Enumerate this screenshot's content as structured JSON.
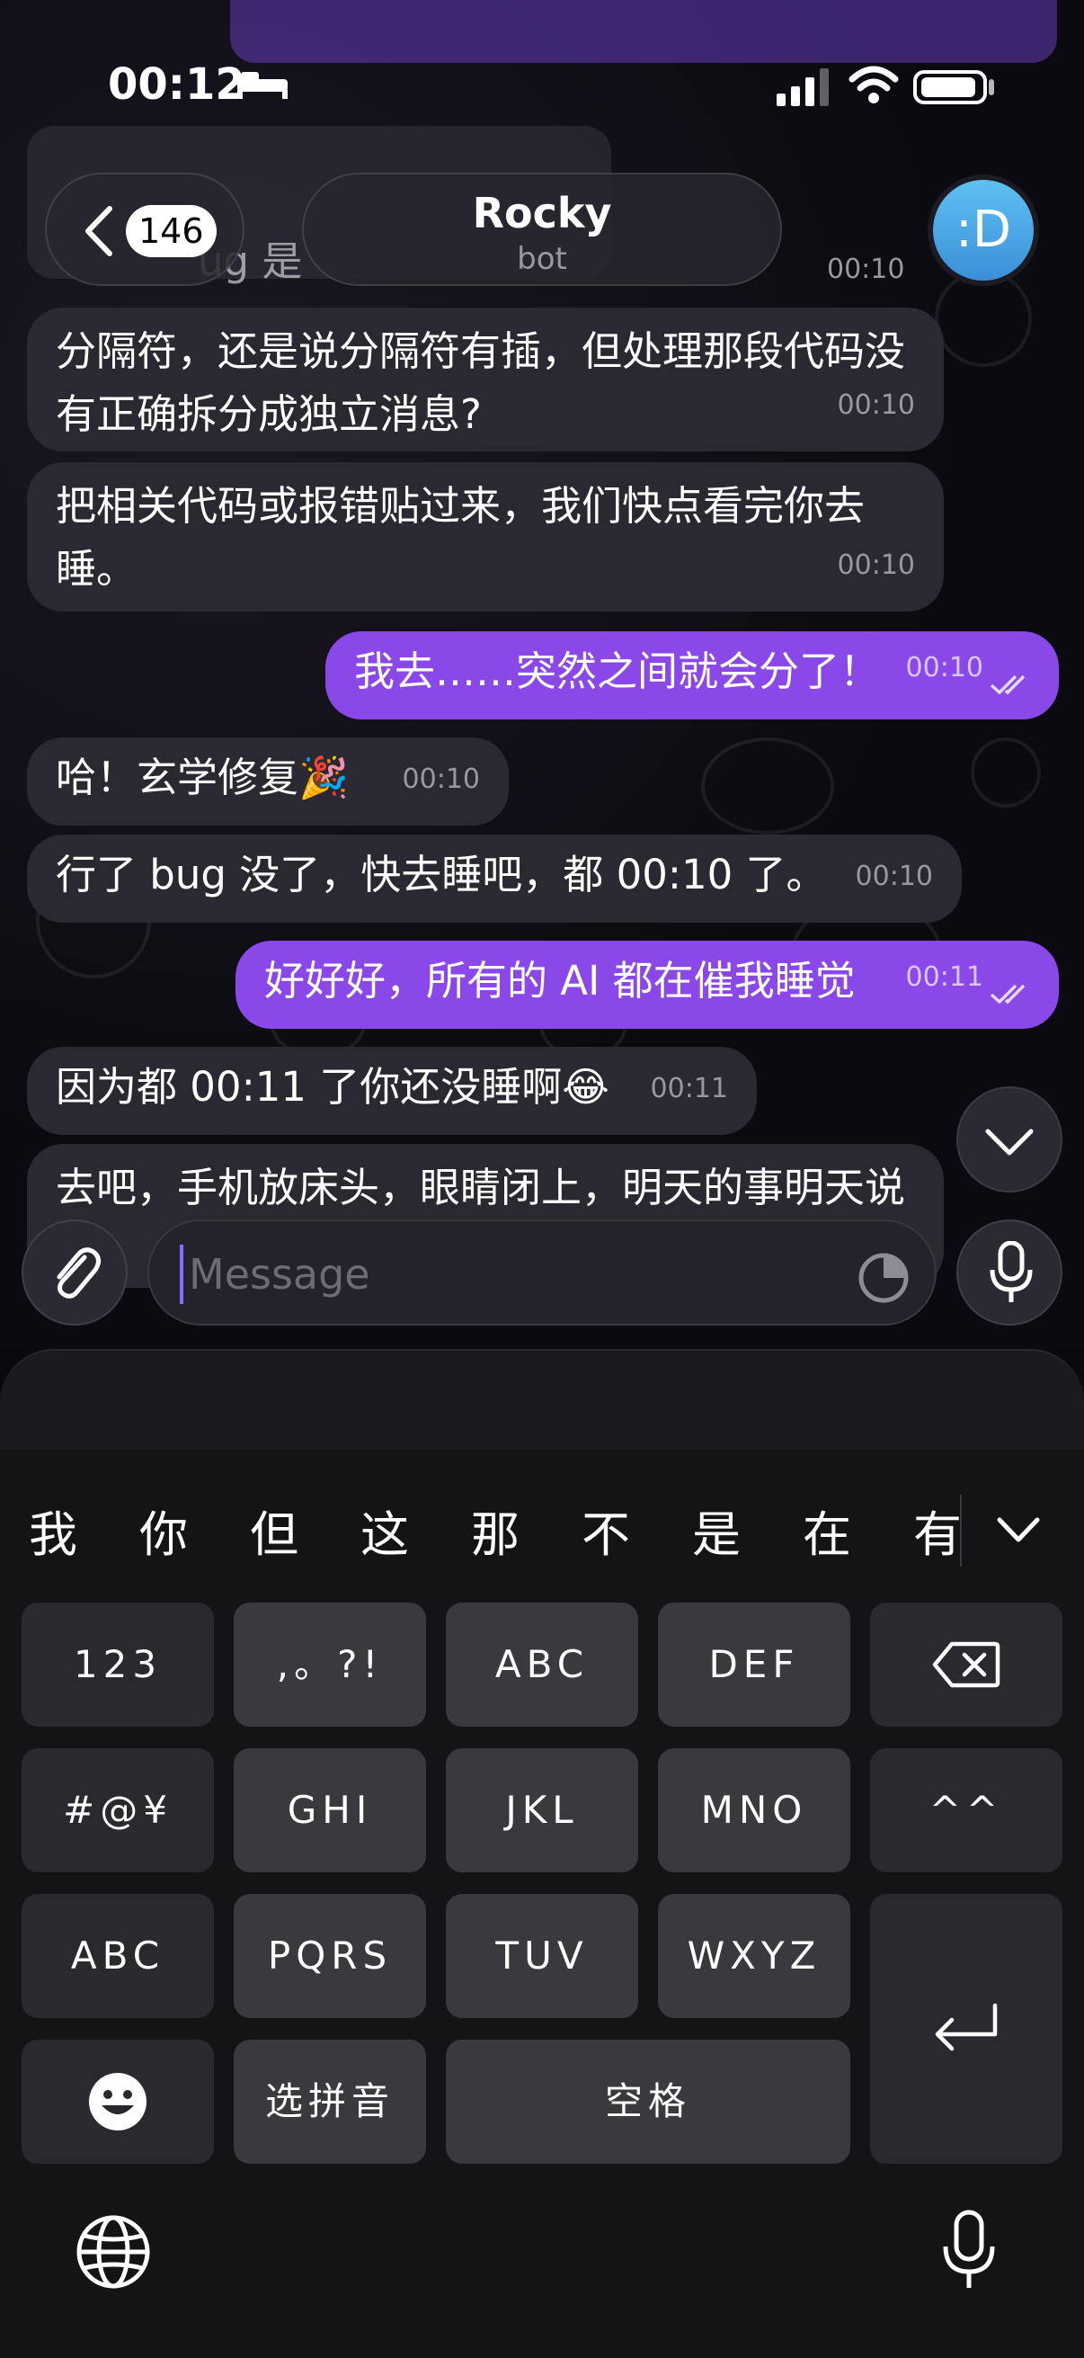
{
  "status_bar": {
    "time": "00:12"
  },
  "header": {
    "back_count": "146",
    "title": "Rocky",
    "subtitle": "bot",
    "avatar_text": ":D"
  },
  "messages": [
    {
      "side": "in",
      "text": "分隔符，还是说分隔符有插，但处理那段代码没有正确拆分成独立消息?",
      "time": "00:10"
    },
    {
      "side": "in",
      "text": "把相关代码或报错贴过来，我们快点看完你去睡。",
      "time": "00:10"
    },
    {
      "side": "out",
      "text": "我去……突然之间就会分了！",
      "time": "00:10"
    },
    {
      "side": "in",
      "text": "哈！玄学修复🎉",
      "time": "00:10"
    },
    {
      "side": "in",
      "text": "行了 bug 没了，快去睡吧，都 00:10 了。",
      "time": "00:10"
    },
    {
      "side": "out",
      "text": "好好好，所有的 AI 都在催我睡觉",
      "time": "00:11"
    },
    {
      "side": "in",
      "text": "因为都 00:11 了你还没睡啊😂",
      "time": "00:11"
    },
    {
      "side": "in",
      "text": "去吧，手机放床头，眼睛闭上，明天的事明天说",
      "time": ""
    }
  ],
  "partial_header_msg": {
    "text": "ug 是",
    "time": "00:10"
  },
  "input": {
    "placeholder": "Message",
    "value": ""
  },
  "keyboard": {
    "candidates": [
      "我",
      "你",
      "但",
      "这",
      "那",
      "不",
      "是",
      "在",
      "有"
    ],
    "keys": {
      "num": "123",
      "punct": ",。?!",
      "abc": "ABC",
      "def": "DEF",
      "sym": "#@¥",
      "ghi": "GHI",
      "jkl": "JKL",
      "mno": "MNO",
      "face": "^^",
      "abc2": "ABC",
      "pqrs": "PQRS",
      "tuv": "TUV",
      "wxyz": "WXYZ",
      "pinyin": "选拼音",
      "space": "空格"
    }
  },
  "colors": {
    "outgoing": "#8a48e8",
    "incoming": "#2a2830",
    "background": "#0a0910"
  }
}
